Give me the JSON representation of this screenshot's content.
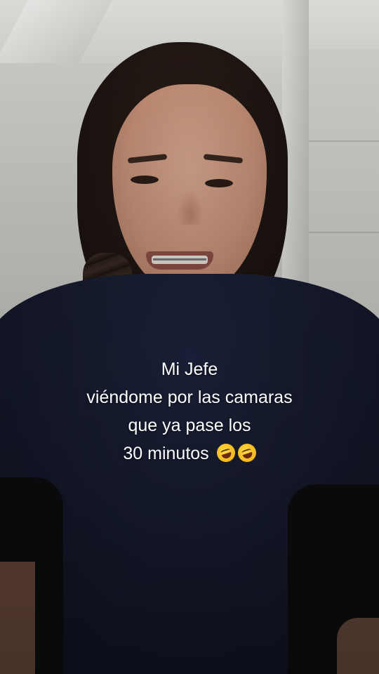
{
  "caption": {
    "line1": "Mi Jefe",
    "line2": "viéndome por las camaras",
    "line3": "que ya pase los",
    "line4": "30 minutos",
    "emojis": [
      "rolling-on-floor-laughing-emoji",
      "rolling-on-floor-laughing-emoji"
    ]
  }
}
